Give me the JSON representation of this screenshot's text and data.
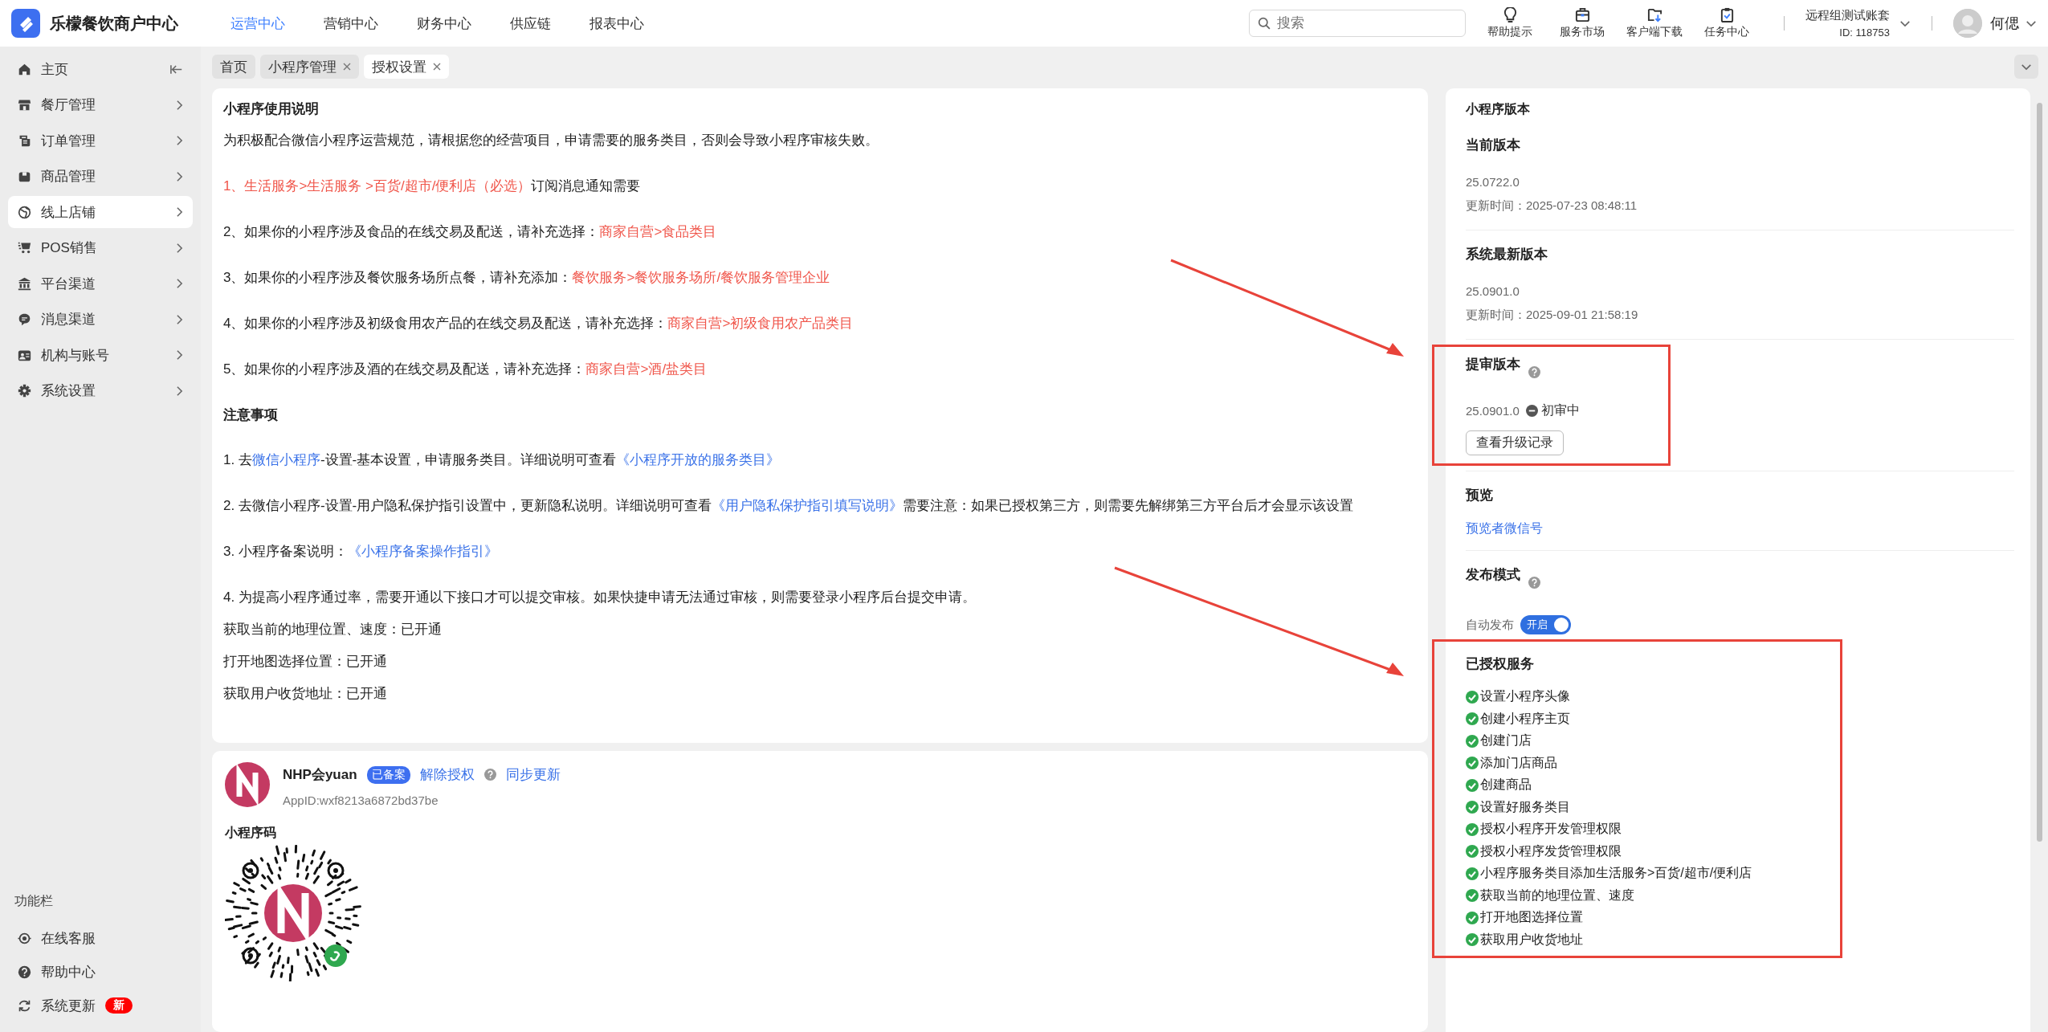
{
  "app": {
    "name": "乐檬餐饮商户中心"
  },
  "top_nav": [
    {
      "label": "运营中心",
      "selected": true
    },
    {
      "label": "营销中心",
      "selected": false
    },
    {
      "label": "财务中心",
      "selected": false
    },
    {
      "label": "供应链",
      "selected": false
    },
    {
      "label": "报表中心",
      "selected": false
    }
  ],
  "search": {
    "placeholder": "搜索"
  },
  "tools": [
    {
      "label": "帮助提示",
      "kind": "bulb"
    },
    {
      "label": "服务市场",
      "kind": "bag"
    },
    {
      "label": "客户端下载",
      "kind": "download"
    },
    {
      "label": "任务中心",
      "kind": "task"
    }
  ],
  "account": {
    "name": "远程组测试账套",
    "id": "ID: 118753"
  },
  "user": {
    "name": "何偲"
  },
  "sidebar": {
    "items": [
      {
        "label": "主页",
        "kind": "home",
        "selected": false
      },
      {
        "label": "餐厅管理",
        "kind": "store",
        "selected": false
      },
      {
        "label": "订单管理",
        "kind": "order",
        "selected": false
      },
      {
        "label": "商品管理",
        "kind": "goods",
        "selected": false
      },
      {
        "label": "线上店铺",
        "kind": "globe",
        "selected": true
      },
      {
        "label": "POS销售",
        "kind": "cart",
        "selected": false
      },
      {
        "label": "平台渠道",
        "kind": "bank",
        "selected": false
      },
      {
        "label": "消息渠道",
        "kind": "chat",
        "selected": false
      },
      {
        "label": "机构与账号",
        "kind": "card",
        "selected": false
      },
      {
        "label": "系统设置",
        "kind": "gear",
        "selected": false
      }
    ]
  },
  "function_bar": {
    "title": "功能栏",
    "items": [
      {
        "label": "在线客服",
        "kind": "service"
      },
      {
        "label": "帮助中心",
        "kind": "help"
      },
      {
        "label": "系统更新",
        "kind": "update",
        "badge": "新"
      }
    ]
  },
  "tabs": [
    {
      "label": "首页",
      "closable": false,
      "selected": false
    },
    {
      "label": "小程序管理",
      "closable": true,
      "selected": false
    },
    {
      "label": "授权设置",
      "closable": true,
      "selected": true
    }
  ],
  "usage": {
    "title": "小程序使用说明",
    "intro": "为积极配合微信小程序运营规范，请根据您的经营项目，申请需要的服务类目，否则会导致小程序审核失败。",
    "rules": [
      [
        {
          "text": "1、生活服务>生活服务 >百货/超市/便利店（必选）",
          "kind": "highlight"
        },
        {
          "text": "订阅消息通知需要",
          "kind": "text"
        }
      ],
      [
        {
          "text": "2、如果你的小程序涉及食品的在线交易及配送，请补充选择：",
          "kind": "text"
        },
        {
          "text": "商家自营>食品类目",
          "kind": "highlight"
        }
      ],
      [
        {
          "text": "3、如果你的小程序涉及餐饮服务场所点餐，请补充添加：",
          "kind": "text"
        },
        {
          "text": "餐饮服务>餐饮服务场所/餐饮服务管理企业",
          "kind": "highlight"
        }
      ],
      [
        {
          "text": "4、如果你的小程序涉及初级食用农产品的在线交易及配送，请补充选择：",
          "kind": "text"
        },
        {
          "text": "商家自营>初级食用农产品类目",
          "kind": "highlight"
        }
      ],
      [
        {
          "text": "5、如果你的小程序涉及酒的在线交易及配送，请补充选择：",
          "kind": "text"
        },
        {
          "text": "商家自营>酒/盐类目",
          "kind": "highlight"
        }
      ]
    ],
    "notes_title": "注意事项",
    "notes": [
      [
        {
          "text": "1. 去",
          "kind": "text"
        },
        {
          "text": "微信小程序",
          "kind": "link"
        },
        {
          "text": "-设置-基本设置，申请服务类目。详细说明可查看",
          "kind": "text"
        },
        {
          "text": "《小程序开放的服务类目》",
          "kind": "link"
        }
      ],
      [
        {
          "text": "2. 去微信小程序-设置-用户隐私保护指引设置中，更新隐私说明。详细说明可查看",
          "kind": "text"
        },
        {
          "text": "《用户隐私保护指引填写说明》",
          "kind": "link"
        },
        {
          "text": "需要注意：如果已授权第三方，则需要先解绑第三方平台后才会显示该设置",
          "kind": "text"
        }
      ],
      [
        {
          "text": "3. 小程序备案说明：",
          "kind": "text"
        },
        {
          "text": "《小程序备案操作指引》",
          "kind": "link"
        }
      ],
      [
        {
          "text": "4. 为提高小程序通过率，需要开通以下接口才可以提交审核。如果快捷申请无法通过审核，则需要登录小程序后台提交申请。",
          "kind": "text"
        }
      ]
    ],
    "interfaces": [
      "获取当前的地理位置、速度：已开通",
      "打开地图选择位置：已开通",
      "获取用户收货地址：已开通"
    ]
  },
  "app_card": {
    "name": "NHP会yuan",
    "badge": "已备案",
    "unbind": "解除授权",
    "sync": "同步更新",
    "appid": "AppID:wxf8213a6872bd37be",
    "qr_title": "小程序码"
  },
  "version_panel": {
    "title": "小程序版本",
    "current": {
      "title": "当前版本",
      "version": "25.0722.0",
      "updated": "更新时间：2025-07-23 08:48:11"
    },
    "latest": {
      "title": "系统最新版本",
      "version": "25.0901.0",
      "updated": "更新时间：2025-09-01 21:58:19"
    },
    "review": {
      "title": "提审版本",
      "version": "25.0901.0",
      "status": "初审中",
      "button": "查看升级记录",
      "highlighted": true
    },
    "preview": {
      "title": "预览",
      "link": "预览者微信号"
    },
    "publish": {
      "title": "发布模式",
      "label": "自动发布",
      "toggle": {
        "on": true,
        "text": "开启"
      }
    },
    "authorized": {
      "title": "已授权服务",
      "highlighted": true,
      "items": [
        "设置小程序头像",
        "创建小程序主页",
        "创建门店",
        "添加门店商品",
        "创建商品",
        "设置好服务类目",
        "授权小程序开发管理权限",
        "授权小程序发货管理权限",
        "小程序服务类目添加生活服务>百货/超市/便利店",
        "获取当前的地理位置、速度",
        "打开地图选择位置",
        "获取用户收货地址"
      ]
    }
  }
}
